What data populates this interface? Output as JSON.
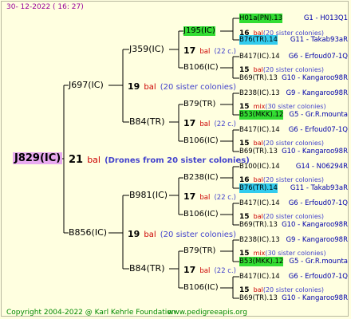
{
  "header": {
    "date": "30- 12-2022 ( 16: 27)"
  },
  "footer": {
    "copyright": "Copyright 2004-2022 @ Karl Kehrle Foundation",
    "url": "www.pedigreeapis.org"
  },
  "root": {
    "name": "J829(IC)",
    "year": "21",
    "type": "bal",
    "note": "(Drones from 20 sister colonies)"
  },
  "gen1": [
    {
      "name": "J697(IC)",
      "year": "19",
      "type": "bal",
      "note": "(20 sister colonies)"
    },
    {
      "name": "B856(IC)",
      "year": "19",
      "type": "bal",
      "note": "(20 sister colonies)"
    }
  ],
  "gen2": [
    {
      "name": "J359(IC)",
      "year": "17",
      "type": "bal",
      "note": "(22 c.)"
    },
    {
      "name": "B84(TR)",
      "year": "17",
      "type": "bal",
      "note": "(22 c.)"
    },
    {
      "name": "B981(IC)",
      "year": "17",
      "type": "bal",
      "note": "(22 c.)"
    },
    {
      "name": "B84(TR)",
      "year": "17",
      "type": "bal",
      "note": "(22 c.)"
    }
  ],
  "gen3": [
    {
      "name": "J195(IC)",
      "year": "16",
      "type": "bal",
      "note": "(20 sister colonies)",
      "hl": "g"
    },
    {
      "name": "B106(IC)",
      "year": "15",
      "type": "bal",
      "note": "(20 sister colonies)",
      "hl": ""
    },
    {
      "name": "B79(TR)",
      "year": "15",
      "type": "mix",
      "note": "(30 sister colonies)",
      "hl": ""
    },
    {
      "name": "B106(IC)",
      "year": "15",
      "type": "bal",
      "note": "(20 sister colonies)",
      "hl": ""
    },
    {
      "name": "B238(IC)",
      "year": "16",
      "type": "bal",
      "note": "(20 sister colonies)",
      "hl": ""
    },
    {
      "name": "B106(IC)",
      "year": "15",
      "type": "bal",
      "note": "(20 sister colonies)",
      "hl": ""
    },
    {
      "name": "B79(TR)",
      "year": "15",
      "type": "mix",
      "note": "(30 sister colonies)",
      "hl": ""
    },
    {
      "name": "B106(IC)",
      "year": "15",
      "type": "bal",
      "note": "(20 sister colonies)",
      "hl": ""
    }
  ],
  "gen4": [
    {
      "name": "H01a(PN).13",
      "info": "G1 - H013Q1",
      "hl": "g"
    },
    {
      "name": "B76(TR).14",
      "info": "G11 - Takab93aR",
      "hl": "c"
    },
    {
      "name": "B417(IC).14",
      "info": "G6 - Erfoud07-1Q",
      "hl": ""
    },
    {
      "name": "B69(TR).13",
      "info": "G10 - Kangaroo98R",
      "hl": ""
    },
    {
      "name": "B238(IC).13",
      "info": "G9 - Kangaroo98R",
      "hl": ""
    },
    {
      "name": "B53(MKK).12",
      "info": "G5 - Gr.R.mounta",
      "hl": "g"
    },
    {
      "name": "B417(IC).14",
      "info": "G6 - Erfoud07-1Q",
      "hl": ""
    },
    {
      "name": "B69(TR).13",
      "info": "G10 - Kangaroo98R",
      "hl": ""
    },
    {
      "name": "B100(IC).14",
      "info": "G14 - N06294R",
      "hl": ""
    },
    {
      "name": "B76(TR).14",
      "info": "G11 - Takab93aR",
      "hl": "c"
    },
    {
      "name": "B417(IC).14",
      "info": "G6 - Erfoud07-1Q",
      "hl": ""
    },
    {
      "name": "B69(TR).13",
      "info": "G10 - Kangaroo98R",
      "hl": ""
    },
    {
      "name": "B238(IC).13",
      "info": "G9 - Kangaroo98R",
      "hl": ""
    },
    {
      "name": "B53(MKK).12",
      "info": "G5 - Gr.R.mounta",
      "hl": "g"
    },
    {
      "name": "B417(IC).14",
      "info": "G6 - Erfoud07-1Q",
      "hl": ""
    },
    {
      "name": "B69(TR).13",
      "info": "G10 - Kangaroo98R",
      "hl": ""
    }
  ],
  "colors": {
    "background": "#ffffe0",
    "root_highlight": "#e8aaf0",
    "green_highlight": "#33dd33",
    "cyan_highlight": "#33ccee",
    "bal_text": "#cc0000",
    "note_text": "#4444cc"
  }
}
